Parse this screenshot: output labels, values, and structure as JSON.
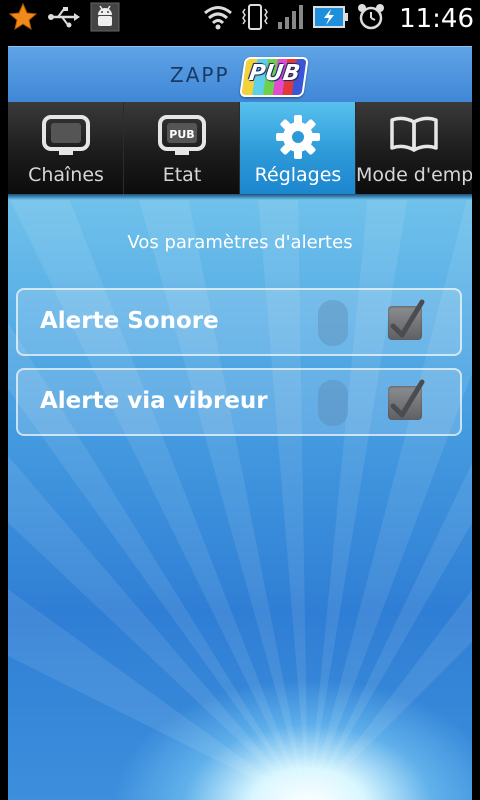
{
  "status_bar": {
    "icons": [
      "star-icon",
      "usb-icon",
      "android-debug-icon",
      "wifi-icon",
      "vibrate-icon",
      "signal-icon",
      "battery-charging-icon",
      "alarm-icon"
    ],
    "time": "11:46"
  },
  "header": {
    "logo_text": "ZAPP",
    "logo_badge": "PUB"
  },
  "tabs": [
    {
      "label": "Chaînes",
      "icon": "tv-icon",
      "selected": false
    },
    {
      "label": "Etat",
      "icon": "pub-tv-icon",
      "selected": false
    },
    {
      "label": "Réglages",
      "icon": "gear-icon",
      "selected": true
    },
    {
      "label": "Mode d'emploi",
      "icon": "book-icon",
      "selected": false
    }
  ],
  "content": {
    "section_title": "Vos paramètres d'alertes",
    "settings": [
      {
        "label": "Alerte Sonore",
        "checked": true
      },
      {
        "label": "Alerte via vibreur",
        "checked": true
      }
    ]
  },
  "colors": {
    "tab_selected": "#2d9ad8",
    "header_blue": "#3f86d6",
    "background_blue": "#2f7ed5"
  }
}
